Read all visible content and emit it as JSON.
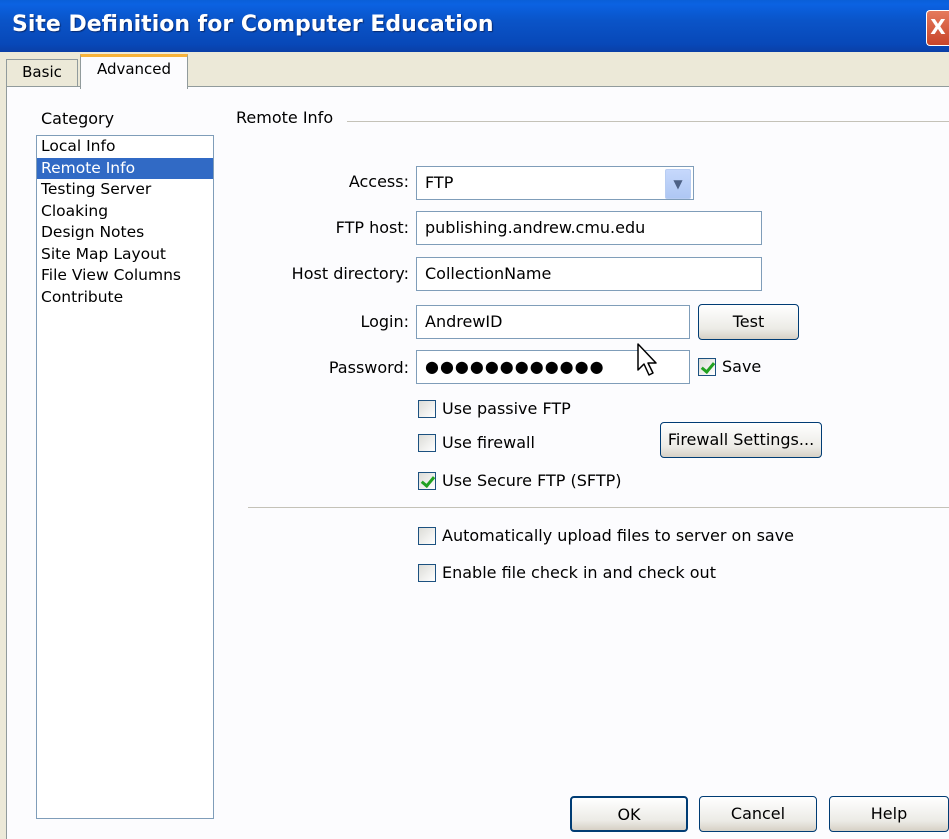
{
  "window": {
    "title": "Site Definition for Computer Education",
    "close_glyph": "X"
  },
  "tabs": [
    {
      "label": "Basic"
    },
    {
      "label": "Advanced",
      "active": true
    }
  ],
  "category": {
    "title": "Category",
    "items": [
      "Local Info",
      "Remote Info",
      "Testing Server",
      "Cloaking",
      "Design Notes",
      "Site Map Layout",
      "File View Columns",
      "Contribute"
    ],
    "selected": "Remote Info"
  },
  "remote_info": {
    "section_title": "Remote Info",
    "access": {
      "label": "Access:",
      "value": "FTP"
    },
    "ftp_host": {
      "label": "FTP host:",
      "value": "publishing.andrew.cmu.edu"
    },
    "host_directory": {
      "label": "Host directory:",
      "value": "CollectionName"
    },
    "login": {
      "label": "Login:",
      "value": "AndrewID",
      "test_label": "Test"
    },
    "password": {
      "label": "Password:",
      "value": "●●●●●●●●●●●●",
      "save_label": "Save",
      "save_checked": true
    },
    "passive_ftp": {
      "label": "Use passive FTP",
      "checked": false
    },
    "firewall": {
      "label": "Use firewall",
      "checked": false,
      "settings_label": "Firewall Settings..."
    },
    "sftp": {
      "label": "Use Secure FTP (SFTP)",
      "checked": true
    },
    "auto_upload": {
      "label": "Automatically upload files to server on save",
      "checked": false
    },
    "check_in_out": {
      "label": "Enable file check in and check out",
      "checked": false
    }
  },
  "footer": {
    "ok": "OK",
    "cancel": "Cancel",
    "help": "Help"
  }
}
